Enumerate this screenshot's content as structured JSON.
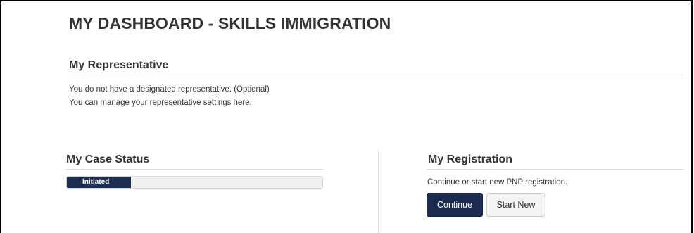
{
  "page": {
    "title": "MY DASHBOARD - SKILLS IMMIGRATION"
  },
  "representative": {
    "heading": "My Representative",
    "line1": "You do not have a designated representative. (Optional)",
    "line2": "You can manage your representative settings here."
  },
  "case_status": {
    "heading": "My Case Status",
    "status_label": "Initiated",
    "progress_fraction": 0.25
  },
  "registration": {
    "heading": "My Registration",
    "description": "Continue or start new PNP registration.",
    "continue_label": "Continue",
    "start_new_label": "Start New"
  },
  "colors": {
    "primary": "#1b2c4f",
    "progress_fill": "#1e2f52",
    "divider": "#dcdcdc"
  }
}
